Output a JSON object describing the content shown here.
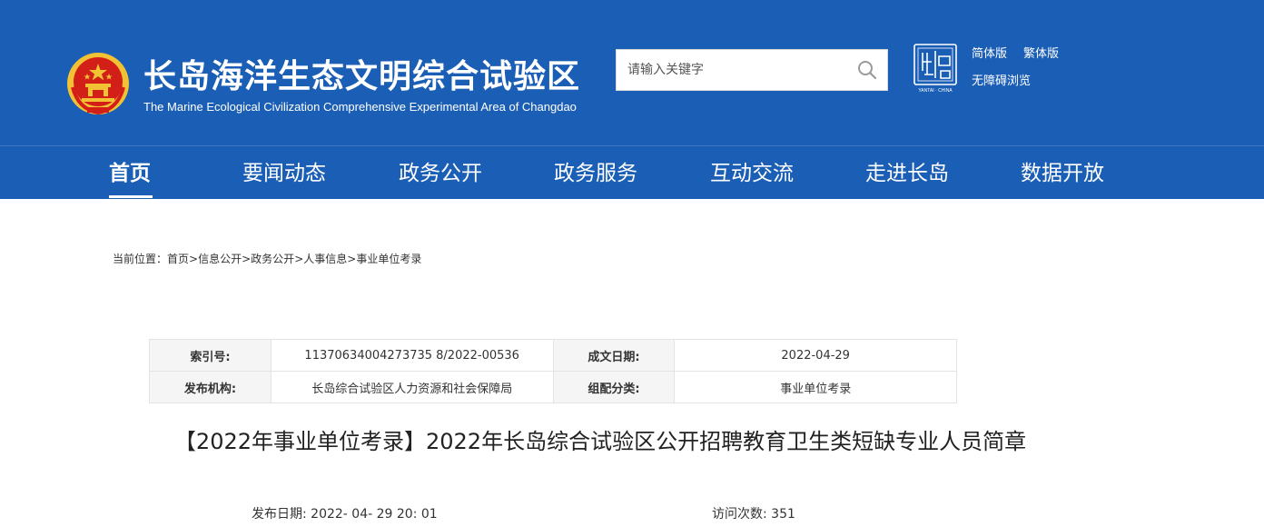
{
  "header": {
    "title_cn": "长岛海洋生态文明综合试验区",
    "title_en": "The Marine Ecological Civilization Comprehensive Experimental Area of Changdao",
    "search": {
      "placeholder": "请输入关键字",
      "icon": "search-icon"
    },
    "seal_logo": {
      "icon": "yantai-china-seal-icon",
      "caption": "YANTAI · CHINA"
    },
    "lang_simplified": "简体版",
    "lang_traditional": "繁体版",
    "accessible": "无障碍浏览",
    "colors": {
      "brand_blue": "#1b5eb5",
      "emblem_red": "#d21f18",
      "emblem_gold": "#f3c234"
    }
  },
  "nav": {
    "items": [
      {
        "label": "首页",
        "active": true
      },
      {
        "label": "要闻动态"
      },
      {
        "label": "政务公开"
      },
      {
        "label": "政务服务"
      },
      {
        "label": "互动交流"
      },
      {
        "label": "走进长岛"
      },
      {
        "label": "数据开放"
      }
    ]
  },
  "breadcrumb": {
    "prefix": "当前位置：",
    "items": [
      "首页",
      "信息公开",
      "政务公开",
      "人事信息",
      "事业单位考录"
    ],
    "separator": ">"
  },
  "meta": {
    "index_label": "索引号:",
    "index_value": "11370634004273735 8/2022-00536",
    "date_label": "成文日期:",
    "date_value": "2022-04-29",
    "org_label": "发布机构:",
    "org_value": "长岛综合试验区人力资源和社会保障局",
    "category_label": "组配分类:",
    "category_value": "事业单位考录"
  },
  "article": {
    "title": "【2022年事业单位考录】2022年长岛综合试验区公开招聘教育卫生类短缺专业人员简章",
    "publish_date": "发布日期:   2022- 04- 29 20: 01",
    "visits": "访问次数: 351"
  }
}
